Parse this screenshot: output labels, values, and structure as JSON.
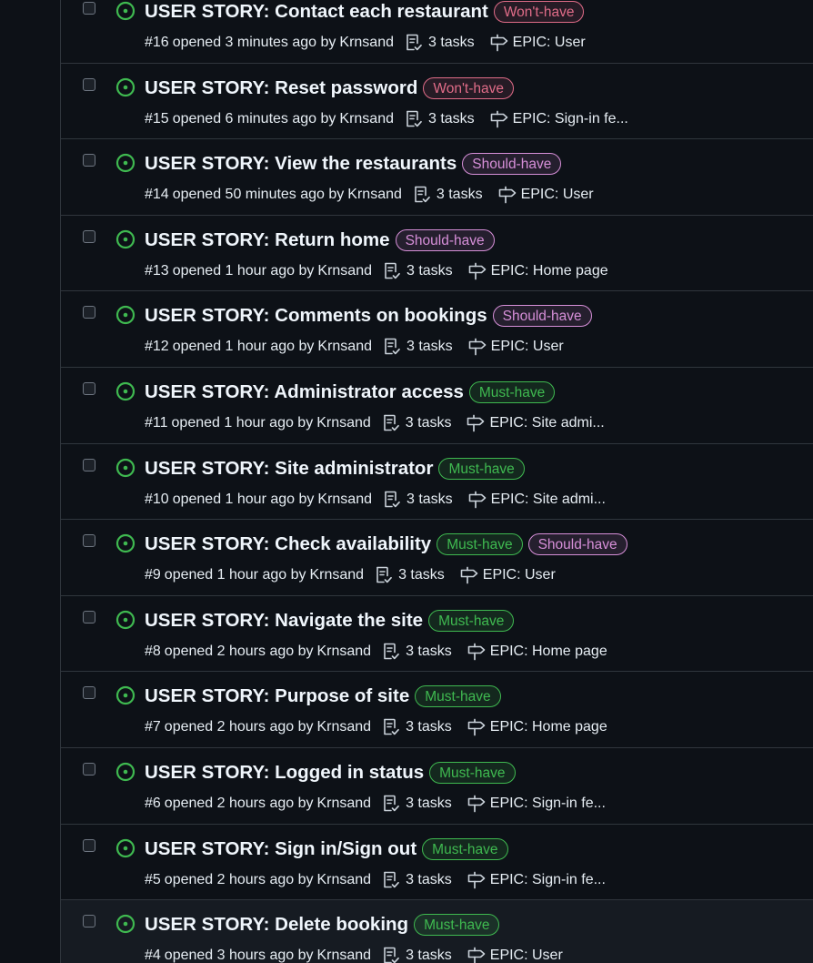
{
  "colors": {
    "background": "#0d1117",
    "row_hover": "#161b22",
    "border": "#30363d",
    "open_green": "#3fb950",
    "wont_have": "#e06c88",
    "should_have": "#d68fd8",
    "must_have": "#3fb950"
  },
  "icons": {
    "status": "issue-opened-icon",
    "tasks": "tasklist-icon",
    "milestone": "milestone-icon"
  },
  "issues": [
    {
      "title": "USER STORY: Contact each restaurant",
      "labels": [
        {
          "text": "Won't-have",
          "kind": "wont"
        }
      ],
      "number": "#16",
      "opened": "opened 3 minutes ago by",
      "author": "Krnsand",
      "tasks": "3 tasks",
      "milestone": "EPIC: User"
    },
    {
      "title": "USER STORY: Reset password",
      "labels": [
        {
          "text": "Won't-have",
          "kind": "wont"
        }
      ],
      "number": "#15",
      "opened": "opened 6 minutes ago by",
      "author": "Krnsand",
      "tasks": "3 tasks",
      "milestone": "EPIC: Sign-in fe..."
    },
    {
      "title": "USER STORY: View the restaurants",
      "labels": [
        {
          "text": "Should-have",
          "kind": "should"
        }
      ],
      "number": "#14",
      "opened": "opened 50 minutes ago by",
      "author": "Krnsand",
      "tasks": "3 tasks",
      "milestone": "EPIC: User"
    },
    {
      "title": "USER STORY: Return home",
      "labels": [
        {
          "text": "Should-have",
          "kind": "should"
        }
      ],
      "number": "#13",
      "opened": "opened 1 hour ago by",
      "author": "Krnsand",
      "tasks": "3 tasks",
      "milestone": "EPIC: Home page"
    },
    {
      "title": "USER STORY: Comments on bookings",
      "labels": [
        {
          "text": "Should-have",
          "kind": "should"
        }
      ],
      "number": "#12",
      "opened": "opened 1 hour ago by",
      "author": "Krnsand",
      "tasks": "3 tasks",
      "milestone": "EPIC: User"
    },
    {
      "title": "USER STORY: Administrator access",
      "labels": [
        {
          "text": "Must-have",
          "kind": "must"
        }
      ],
      "number": "#11",
      "opened": "opened 1 hour ago by",
      "author": "Krnsand",
      "tasks": "3 tasks",
      "milestone": "EPIC: Site admi..."
    },
    {
      "title": "USER STORY: Site administrator",
      "labels": [
        {
          "text": "Must-have",
          "kind": "must"
        }
      ],
      "number": "#10",
      "opened": "opened 1 hour ago by",
      "author": "Krnsand",
      "tasks": "3 tasks",
      "milestone": "EPIC: Site admi..."
    },
    {
      "title": "USER STORY: Check availability",
      "labels": [
        {
          "text": "Must-have",
          "kind": "must"
        },
        {
          "text": "Should-have",
          "kind": "should"
        }
      ],
      "number": "#9",
      "opened": "opened 1 hour ago by",
      "author": "Krnsand",
      "tasks": "3 tasks",
      "milestone": "EPIC: User"
    },
    {
      "title": "USER STORY: Navigate the site",
      "labels": [
        {
          "text": "Must-have",
          "kind": "must"
        }
      ],
      "number": "#8",
      "opened": "opened 2 hours ago by",
      "author": "Krnsand",
      "tasks": "3 tasks",
      "milestone": "EPIC: Home page"
    },
    {
      "title": "USER STORY: Purpose of site",
      "labels": [
        {
          "text": "Must-have",
          "kind": "must"
        }
      ],
      "number": "#7",
      "opened": "opened 2 hours ago by",
      "author": "Krnsand",
      "tasks": "3 tasks",
      "milestone": "EPIC: Home page"
    },
    {
      "title": "USER STORY: Logged in status",
      "labels": [
        {
          "text": "Must-have",
          "kind": "must"
        }
      ],
      "number": "#6",
      "opened": "opened 2 hours ago by",
      "author": "Krnsand",
      "tasks": "3 tasks",
      "milestone": "EPIC: Sign-in fe..."
    },
    {
      "title": "USER STORY: Sign in/Sign out",
      "labels": [
        {
          "text": "Must-have",
          "kind": "must"
        }
      ],
      "number": "#5",
      "opened": "opened 2 hours ago by",
      "author": "Krnsand",
      "tasks": "3 tasks",
      "milestone": "EPIC: Sign-in fe..."
    },
    {
      "title": "USER STORY: Delete booking",
      "labels": [
        {
          "text": "Must-have",
          "kind": "must"
        }
      ],
      "number": "#4",
      "opened": "opened 3 hours ago by",
      "author": "Krnsand",
      "tasks": "3 tasks",
      "milestone": "EPIC: User",
      "hovered": true
    }
  ]
}
